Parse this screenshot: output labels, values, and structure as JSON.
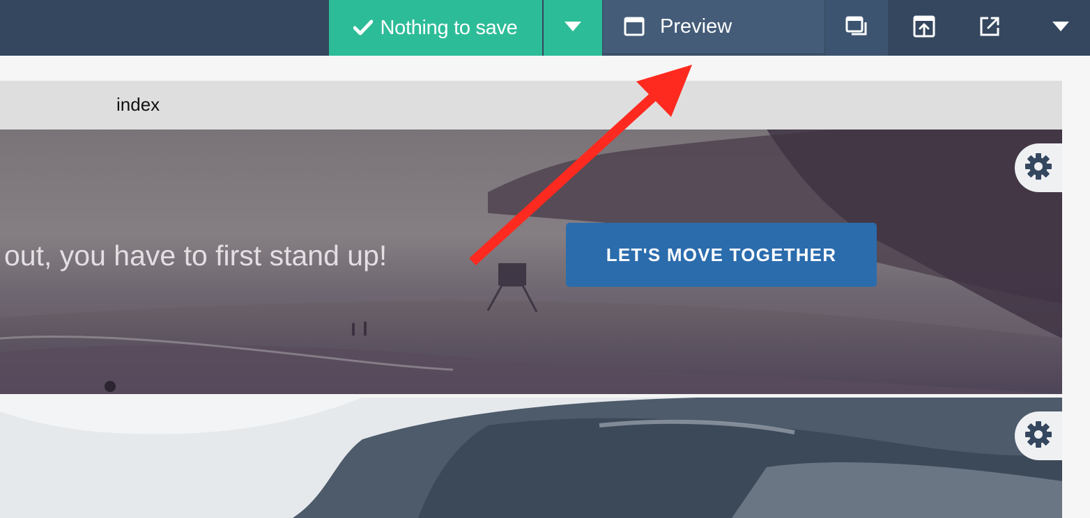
{
  "toolbar": {
    "save_label": "Nothing to save",
    "preview_label": "Preview",
    "icons": {
      "check": "check-icon",
      "save_dropdown": "caret-down-icon",
      "preview": "browser-window-icon",
      "responsive": "responsive-view-icon",
      "publish": "upload-icon",
      "open_external": "external-link-icon",
      "more": "caret-down-icon"
    }
  },
  "page_tab": {
    "label": "index"
  },
  "hero": {
    "text": "out, you have to first stand up!",
    "button_label": "LET'S MOVE TOGETHER"
  },
  "section_settings": {
    "icon": "gear-icon"
  },
  "colors": {
    "toolbar_bg": "#35475f",
    "save_green": "#2dbc98",
    "preview_bg": "#445c78",
    "cta_blue": "#2b6cad",
    "annotation_arrow": "#ff2a1f"
  }
}
